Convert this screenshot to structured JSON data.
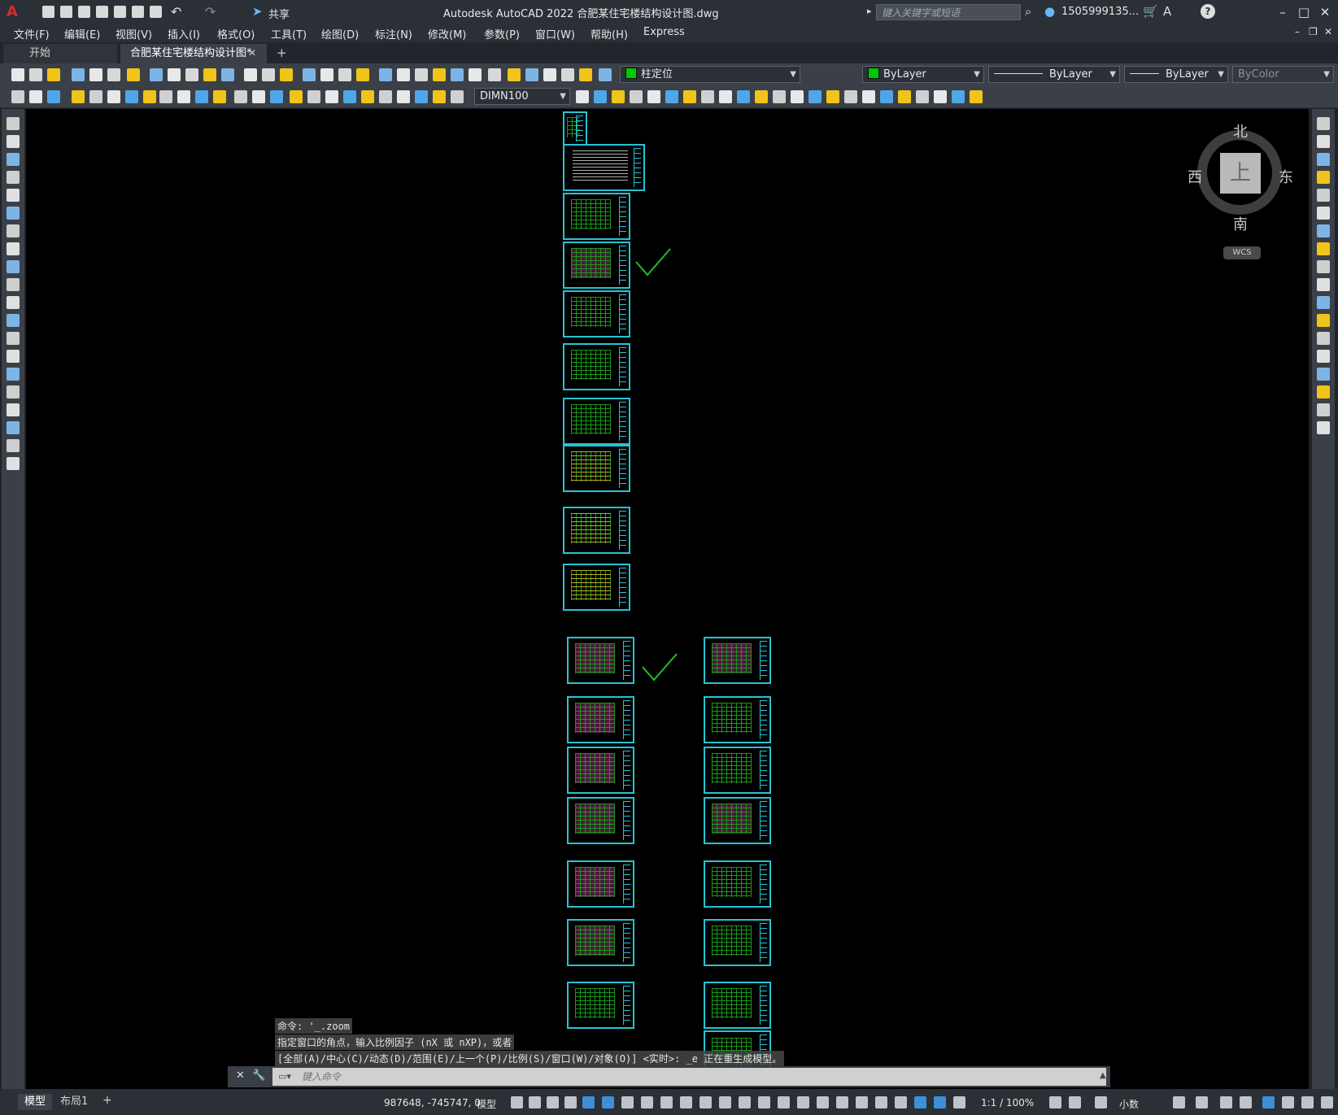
{
  "titlebar": {
    "app_icon": "A",
    "title": "Autodesk AutoCAD 2022    合肥某住宅楼结构设计图.dwg",
    "share_label": "共享",
    "search_placeholder": "键入关键字或短语",
    "user": "1505999135...",
    "icons": [
      "new-file-icon",
      "open-icon",
      "save-icon",
      "saveas-icon",
      "web-mobile-icon",
      "publish-icon",
      "plot-icon",
      "undo-icon",
      "redo-icon",
      "share-icon",
      "search-icon",
      "user-icon",
      "cart-icon",
      "a360-icon",
      "help-icon",
      "minimize-icon",
      "maximize-icon",
      "close-icon"
    ]
  },
  "menu": [
    "文件(F)",
    "编辑(E)",
    "视图(V)",
    "插入(I)",
    "格式(O)",
    "工具(T)",
    "绘图(D)",
    "标注(N)",
    "修改(M)",
    "参数(P)",
    "窗口(W)",
    "帮助(H)",
    "Express"
  ],
  "tabs": [
    {
      "label": "开始"
    },
    {
      "label": "合肥某住宅楼结构设计图*"
    }
  ],
  "layer_toolbar": {
    "current_layer": "柱定位",
    "layer_color": "#00c800",
    "color_value": "ByLayer",
    "linetype_value": "ByLayer",
    "lineweight_value": "ByLayer",
    "plotstyle_value": "ByColor"
  },
  "dim_toolbar": {
    "dimstyle": "DIMN100"
  },
  "viewcube": {
    "north": "北",
    "south": "南",
    "east": "东",
    "west": "西",
    "face": "上",
    "wcs": "WCS"
  },
  "command": {
    "history": [
      "命令: '_.zoom",
      "指定窗口的角点，输入比例因子 (nX 或 nXP)，或者",
      "[全部(A)/中心(C)/动态(D)/范围(E)/上一个(P)/比例(S)/窗口(W)/对象(O)] <实时>: _e 正在重生成模型。"
    ],
    "input_placeholder": "键入命令"
  },
  "status": {
    "tab_model": "模型",
    "tab_layout1": "布局1",
    "coords": "987648, -745747, 0",
    "space": "模型",
    "scale": "1:1 / 100%",
    "units": "小数"
  },
  "colors": {
    "sheet_border": "#27c3d2",
    "plan_green": "#1fb41f",
    "check_green": "#20c020",
    "canvas": "#000000"
  }
}
